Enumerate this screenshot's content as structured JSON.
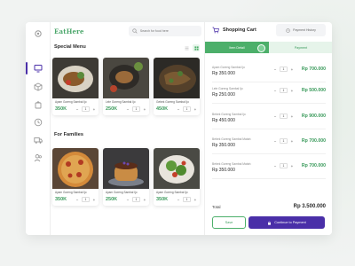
{
  "app": {
    "logo": "EatHere"
  },
  "search": {
    "placeholder": "Search for food here"
  },
  "sections": {
    "special": "Special Menu",
    "families": "For Families"
  },
  "rail_icons": [
    "settings-icon",
    "monitor-icon",
    "box-icon",
    "cart-icon",
    "clock-icon",
    "truck-icon",
    "users-icon"
  ],
  "special_menu": [
    {
      "name": "Ayam Goreng Sambal Ijo",
      "price": "350K",
      "qty": "1"
    },
    {
      "name": "Lele Goreng Sambal Ijo",
      "price": "250K",
      "qty": "1"
    },
    {
      "name": "Gebek Goreng Sambal Ijo",
      "price": "450K",
      "qty": "1"
    }
  ],
  "families_menu": [
    {
      "name": "Ayam Goreng Sambal Ijo",
      "price": "350K",
      "qty": "1"
    },
    {
      "name": "Ayam Goreng Sambal Ijo",
      "price": "250K",
      "qty": "1"
    },
    {
      "name": "Ayam Goreng Sambal Ijo",
      "price": "350K",
      "qty": "1"
    }
  ],
  "cart": {
    "title": "Shopping Cart",
    "payment_history": "Payment History",
    "tabs": [
      "Item Detail",
      "Payment"
    ],
    "items": [
      {
        "name": "Ayam Goreng Sambal Ijo",
        "price": "Rp 350.000",
        "qty": "1",
        "total": "Rp 700.000"
      },
      {
        "name": "Lele Goreng Sambal Ijo",
        "price": "Rp 250.000",
        "qty": "1",
        "total": "Rp 500.000"
      },
      {
        "name": "Bebek Goreng Sambal Ijo",
        "price": "Rp 450.000",
        "qty": "1",
        "total": "Rp 900.000"
      },
      {
        "name": "Bebek Goreng Sambal Matah",
        "price": "Rp 350.000",
        "qty": "1",
        "total": "Rp 700.000"
      },
      {
        "name": "Bebek Goreng Sambal Matah",
        "price": "Rp 350.000",
        "qty": "1",
        "total": "Rp 700.000"
      }
    ],
    "total_label": "Total",
    "total_value": "Rp 3.500.000",
    "save_label": "Save",
    "continue_label": "Continue to Payment"
  },
  "colors": {
    "accent_green": "#4caf6a",
    "price_green": "#3a9a5b",
    "primary_purple": "#4a2fa8"
  }
}
